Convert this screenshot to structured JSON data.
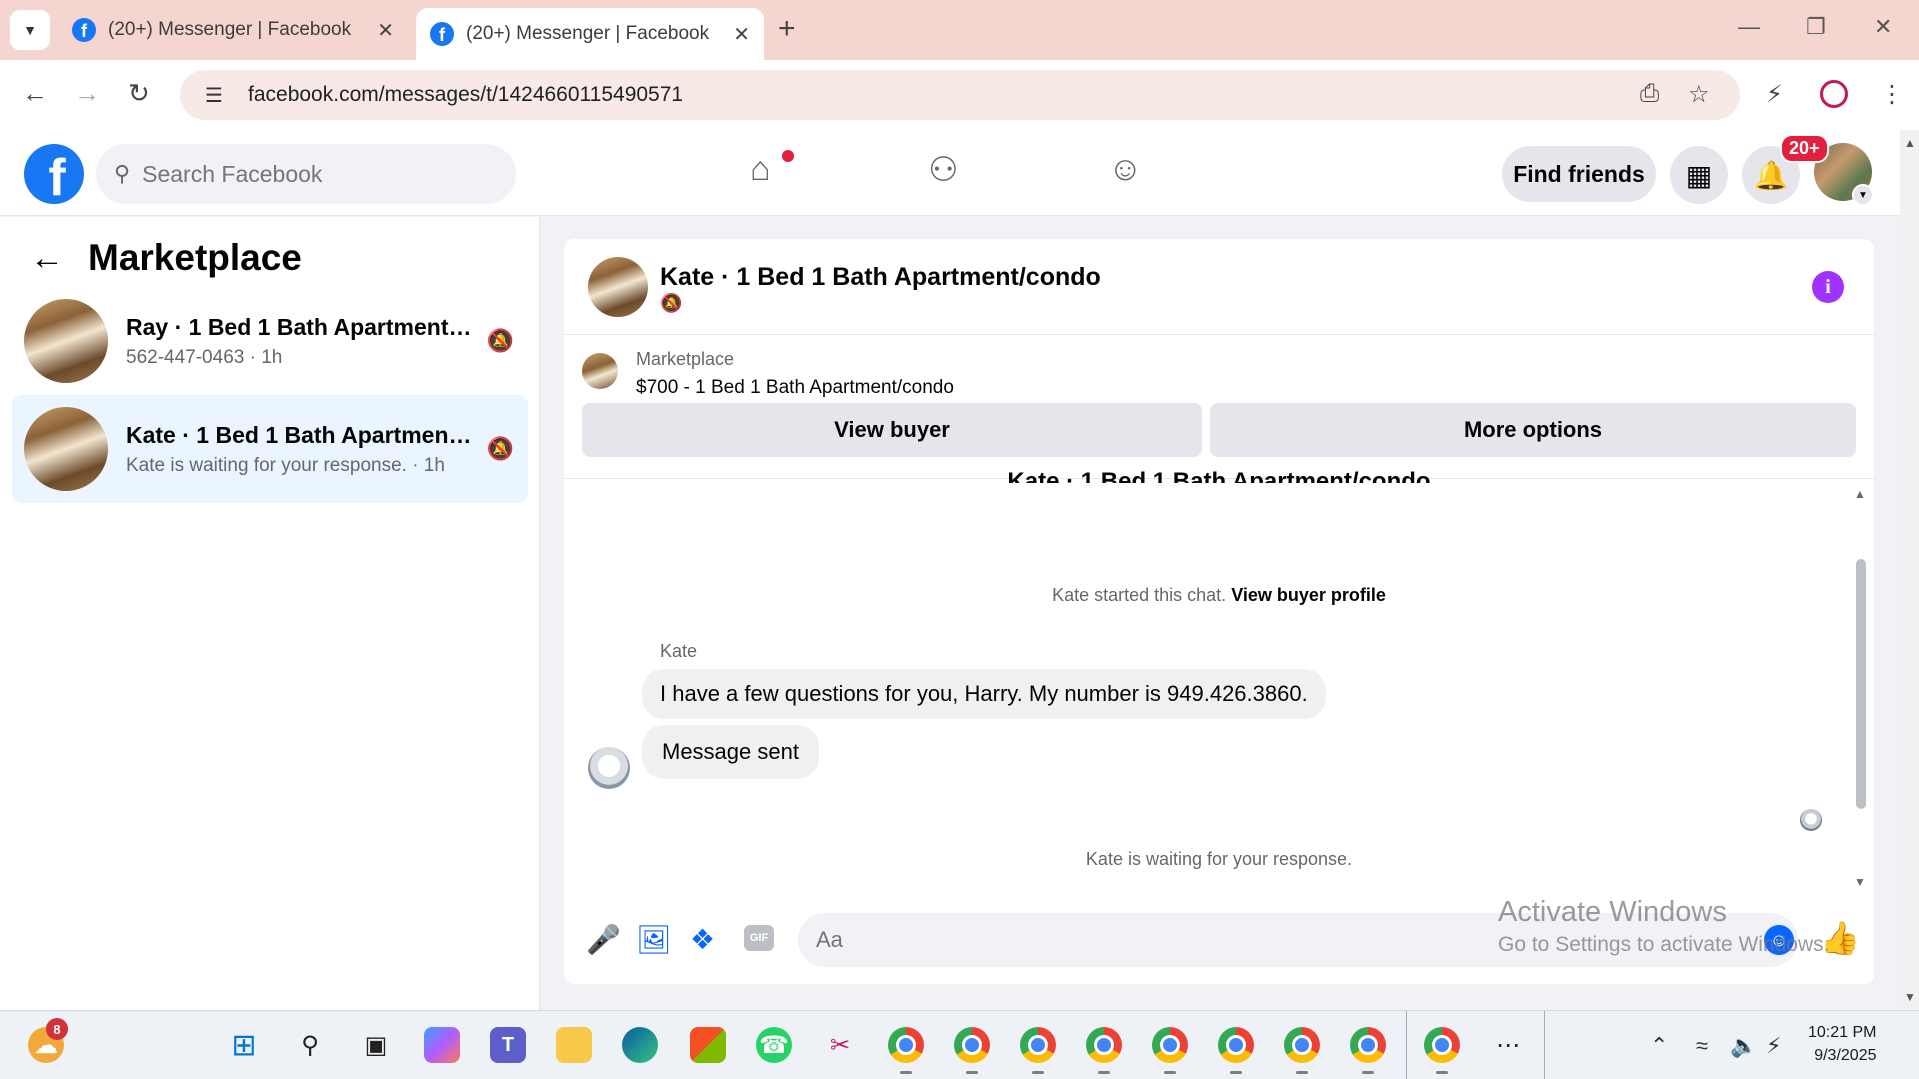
{
  "browser": {
    "tabs": [
      {
        "title": "(20+) Messenger | Facebook",
        "active": false
      },
      {
        "title": "(20+) Messenger | Facebook",
        "active": true
      }
    ],
    "new_tab_symbol": "+",
    "url": "facebook.com/messages/t/1424660115490571"
  },
  "header": {
    "search_placeholder": "Search Facebook",
    "find_friends_label": "Find friends",
    "notification_badge": "20+",
    "icons": {
      "home": "home-icon",
      "friends": "friends-icon",
      "groups": "groups-icon",
      "menu": "apps-grid-icon",
      "notifications": "bell-icon"
    }
  },
  "sidebar": {
    "title": "Marketplace",
    "conversations": [
      {
        "name": "Ray · 1 Bed 1 Bath Apartment/co...",
        "subtitle": "562-447-0463 · 1h",
        "selected": false
      },
      {
        "name": "Kate · 1 Bed 1 Bath Apartment/c...",
        "subtitle": "Kate is waiting for your response. · 1h",
        "selected": true
      }
    ]
  },
  "chat": {
    "title": "Kate · 1 Bed 1 Bath Apartment/condo",
    "listing": {
      "label": "Marketplace",
      "price_title": "$700 - 1 Bed 1 Bath Apartment/condo"
    },
    "buttons": {
      "view_buyer": "View buyer",
      "more_options": "More options"
    },
    "ghost_title": "Kate · 1 Bed 1 Bath Apartment/condo",
    "started_text": "Kate started this chat.",
    "view_buyer_profile": "View buyer profile",
    "sender_name": "Kate",
    "messages": [
      {
        "text": "I have a few questions for you, Harry. My number is 949.426.3860."
      },
      {
        "text": "Message sent"
      }
    ],
    "waiting_text": "Kate is waiting for your response.",
    "composer_placeholder": "Aa",
    "gif_label": "GIF"
  },
  "watermark": {
    "line1": "Activate Windows",
    "line2": "Go to Settings to activate Windows."
  },
  "taskbar": {
    "weather_badge": "8",
    "clock_time": "10:21 PM",
    "clock_date": "9/3/2025"
  },
  "colors": {
    "fb_blue": "#1877f2",
    "messenger_blue": "#0866ff",
    "selected_bg": "#ebf5ff",
    "badge_red": "#e41e3f",
    "info_purple": "#a033ff",
    "tabbar_bg": "#f5d5cf"
  }
}
